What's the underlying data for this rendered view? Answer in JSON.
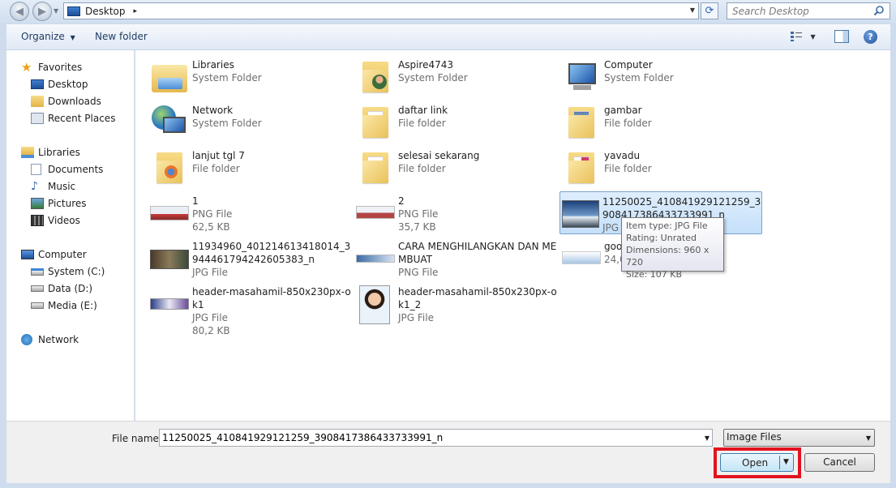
{
  "address": {
    "location": "Desktop",
    "chevron": "▸",
    "search_placeholder": "Search Desktop"
  },
  "toolbar": {
    "organize_label": "Organize",
    "new_folder_label": "New folder",
    "help_label": "?"
  },
  "nav": {
    "favorites": "Favorites",
    "desktop": "Desktop",
    "downloads": "Downloads",
    "recent_places": "Recent Places",
    "libraries": "Libraries",
    "documents": "Documents",
    "music": "Music",
    "pictures": "Pictures",
    "videos": "Videos",
    "computer": "Computer",
    "system_c": "System (C:)",
    "data_d": "Data (D:)",
    "media_e": "Media (E:)",
    "network": "Network"
  },
  "files": [
    {
      "name": "Libraries",
      "type": "System Folder",
      "size": ""
    },
    {
      "name": "Aspire4743",
      "type": "System Folder",
      "size": ""
    },
    {
      "name": "Computer",
      "type": "System Folder",
      "size": ""
    },
    {
      "name": "Network",
      "type": "System Folder",
      "size": ""
    },
    {
      "name": "daftar link",
      "type": "File folder",
      "size": ""
    },
    {
      "name": "gambar",
      "type": "File folder",
      "size": ""
    },
    {
      "name": "lanjut tgl 7",
      "type": "File folder",
      "size": ""
    },
    {
      "name": "selesai sekarang",
      "type": "File folder",
      "size": ""
    },
    {
      "name": "yavadu",
      "type": "File folder",
      "size": ""
    },
    {
      "name": "1",
      "type": "PNG File",
      "size": "62,5 KB"
    },
    {
      "name": "2",
      "type": "PNG File",
      "size": "35,7 KB"
    },
    {
      "name": "11250025_410841929121259_3908417386433733991_n",
      "type": "JPG File",
      "size": ""
    },
    {
      "name": "11934960_401214613418014_3944461794242605383_n",
      "type": "JPG File",
      "size": ""
    },
    {
      "name": "CARA MENGHILANGKAN DAN MEMBUAT",
      "type": "PNG File",
      "size": ""
    },
    {
      "name": "goo",
      "type": "",
      "size": "24,0 KB"
    },
    {
      "name": "header-masahamil-850x230px-ok1",
      "type": "JPG File",
      "size": "80,2 KB"
    },
    {
      "name": "header-masahamil-850x230px-ok1_2",
      "type": "JPG File",
      "size": ""
    }
  ],
  "tooltip": {
    "item_type": "Item type: JPG File",
    "rating": "Rating: Unrated",
    "dimensions": "Dimensions: 960 x 720",
    "size": "Size: 107 KB"
  },
  "bottom": {
    "file_name_label": "File name:",
    "file_name_value": "11250025_410841929121259_3908417386433733991_n",
    "filter": "Image Files",
    "open_label": "Open",
    "cancel_label": "Cancel"
  },
  "colors": {
    "highlight_outline": "#e1131f",
    "selection": "#c5e0fa",
    "accent": "#3c7fb1"
  }
}
